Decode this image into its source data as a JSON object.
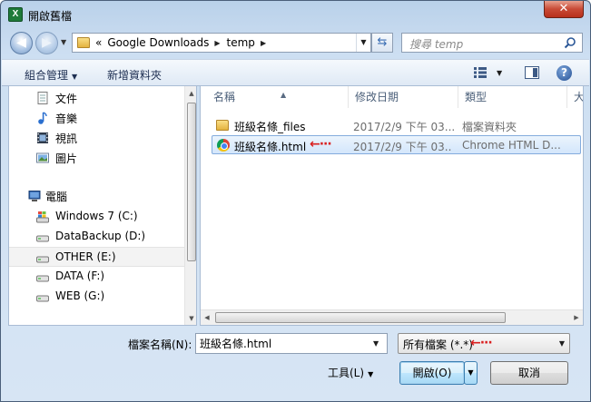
{
  "window": {
    "title": "開啟舊檔",
    "app_icon_letter": "X",
    "close_glyph": "✕"
  },
  "nav": {
    "breadcrumb": [
      "«",
      "Google Downloads",
      "temp"
    ],
    "search_placeholder": "搜尋 temp"
  },
  "toolbar": {
    "organize": "組合管理",
    "new_folder": "新增資料夾"
  },
  "sidebar": {
    "libraries": [
      {
        "label": "文件",
        "icon": "document-icon"
      },
      {
        "label": "音樂",
        "icon": "music-icon"
      },
      {
        "label": "視訊",
        "icon": "video-icon"
      },
      {
        "label": "圖片",
        "icon": "picture-icon"
      }
    ],
    "computer_label": "電腦",
    "drives": [
      {
        "label": "Windows 7 (C:)"
      },
      {
        "label": "DataBackup (D:)"
      },
      {
        "label": "OTHER (E:)",
        "selected": true
      },
      {
        "label": "DATA (F:)"
      },
      {
        "label": "WEB (G:)"
      }
    ]
  },
  "columns": {
    "name": "名稱",
    "date": "修改日期",
    "type": "類型",
    "size": "大"
  },
  "files": [
    {
      "name": "班級名條_files",
      "date": "2017/2/9 下午 03...",
      "type": "檔案資料夾",
      "icon": "folder-icon"
    },
    {
      "name": "班級名條.html",
      "date": "2017/2/9 下午 03...",
      "type": "Chrome HTML D...",
      "icon": "chrome-icon",
      "selected": true
    }
  ],
  "footer": {
    "filename_label": "檔案名稱(N):",
    "filename_value": "班級名條.html",
    "filetype": "所有檔案 (*.*)",
    "tools": "工具(L)",
    "open": "開啟(O)",
    "cancel": "取消"
  },
  "annotation": {
    "arrow": "←···"
  },
  "colors": {
    "accent_red": "#d91f1f",
    "selection_border": "#84acdd"
  }
}
